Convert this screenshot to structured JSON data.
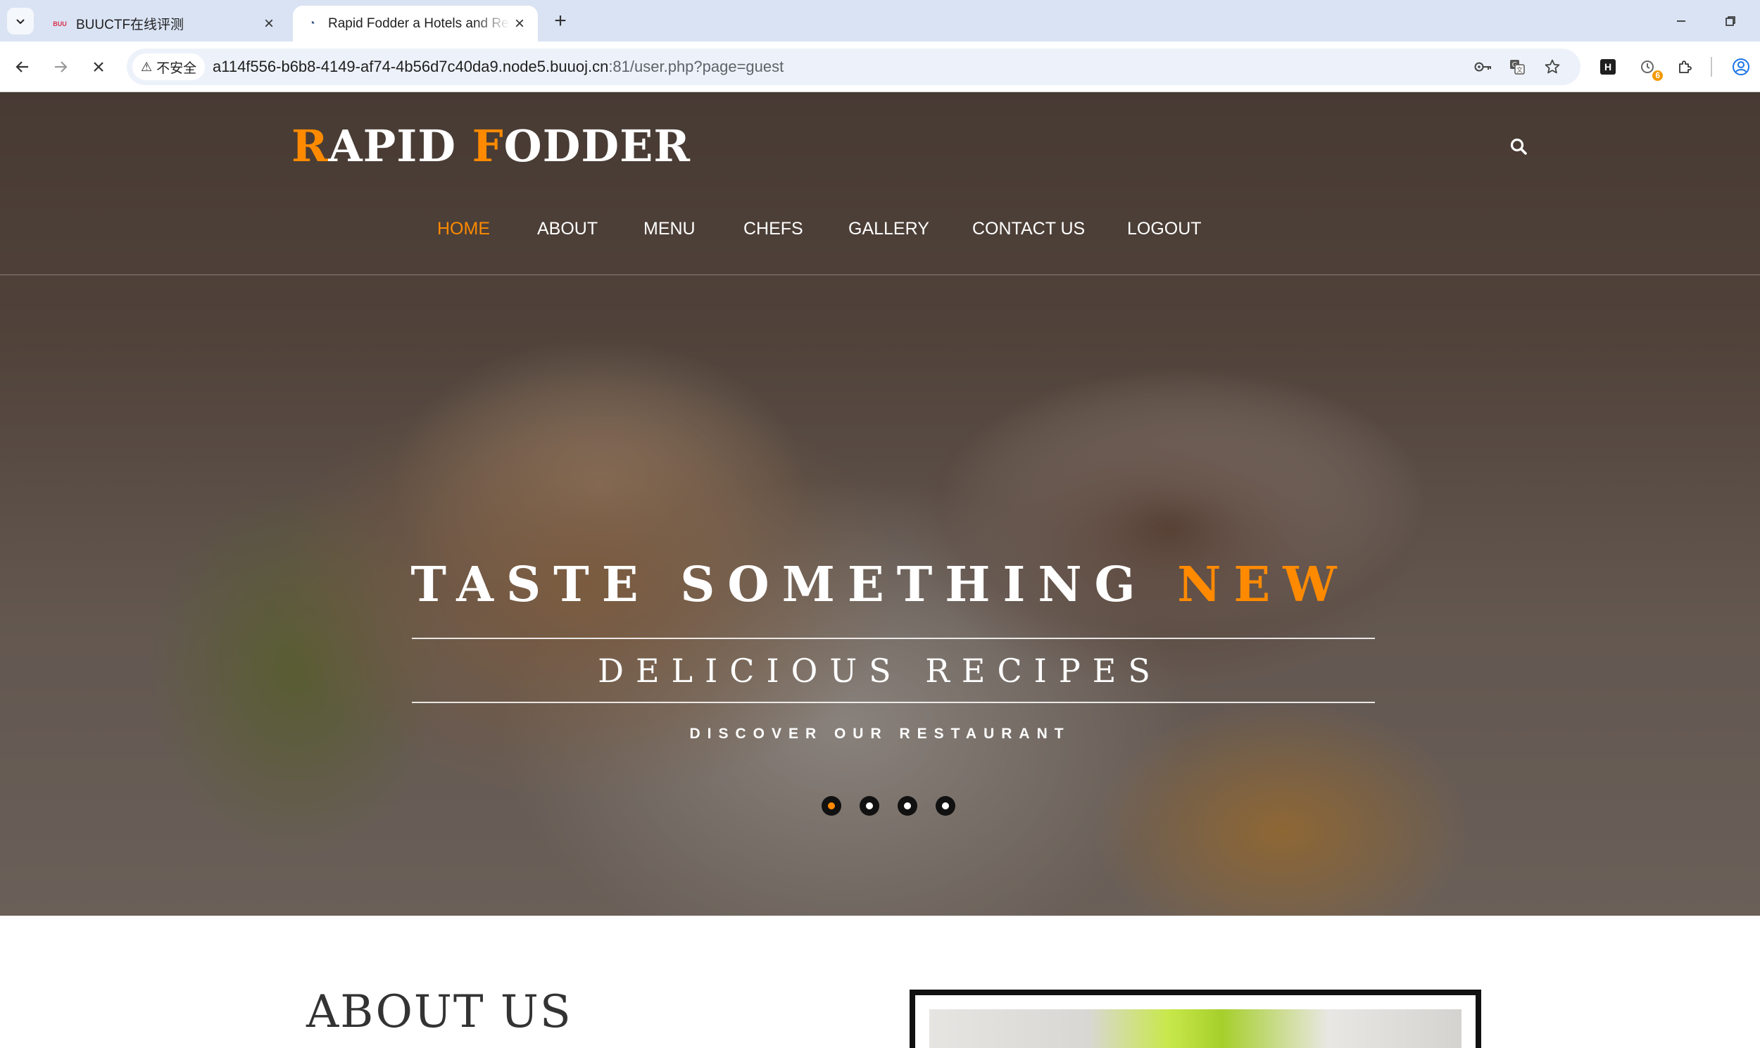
{
  "browser": {
    "tabs": [
      {
        "title": "BUUCTF在线评测",
        "active": false
      },
      {
        "title": "Rapid Fodder a Hotels and Restaurants",
        "active": true
      }
    ],
    "security_label": "不安全",
    "url_host": "a114f556-b6b8-4149-af74-4b56d7c40da9.node5.buuoj.cn",
    "url_path": ":81/user.php?page=guest",
    "extension_badge": "6"
  },
  "site": {
    "logo": {
      "first_initial": "R",
      "first_rest": "APID ",
      "second_initial": "F",
      "second_rest": "ODDER"
    },
    "nav": [
      "HOME",
      "ABOUT",
      "MENU",
      "CHEFS",
      "GALLERY",
      "CONTACT US",
      "LOGOUT"
    ],
    "active_nav": "HOME",
    "hero": {
      "title_main": "TASTE SOMETHING ",
      "title_accent": "NEW",
      "subtitle": "DELICIOUS RECIPES",
      "tagline": "DISCOVER OUR RESTAURANT",
      "slide_count": 4,
      "active_slide": 1
    },
    "about_title": "ABOUT US"
  },
  "colors": {
    "accent": "#ff8a00",
    "text_light": "#ffffff",
    "about_text": "#333333"
  }
}
